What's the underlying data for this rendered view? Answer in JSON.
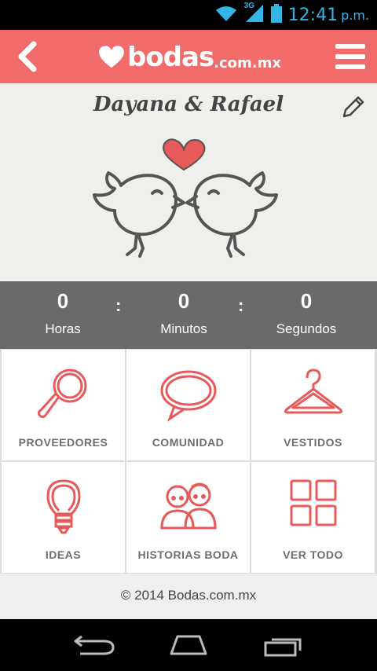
{
  "status": {
    "network": "3G",
    "time": "12:41",
    "ampm": "p.m."
  },
  "header": {
    "brand": "bodas",
    "tld": ".com.mx"
  },
  "hero": {
    "couple": "Dayana & Rafael"
  },
  "countdown": [
    {
      "value": "0",
      "label": "Horas"
    },
    {
      "value": "0",
      "label": "Minutos"
    },
    {
      "value": "0",
      "label": "Segundos"
    }
  ],
  "tiles": [
    {
      "label": "PROVEEDORES",
      "icon": "magnifier-icon"
    },
    {
      "label": "COMUNIDAD",
      "icon": "chat-bubble-icon"
    },
    {
      "label": "VESTIDOS",
      "icon": "hanger-icon"
    },
    {
      "label": "IDEAS",
      "icon": "lightbulb-icon"
    },
    {
      "label": "HISTORIAS BODA",
      "icon": "couple-icon"
    },
    {
      "label": "VER TODO",
      "icon": "grid-icon"
    }
  ],
  "footer": {
    "copyright": "© 2014 Bodas.com.mx"
  },
  "colors": {
    "brand": "#f26b6b",
    "status_blue": "#33b5e5",
    "counter_bg": "#6a6a6a"
  }
}
